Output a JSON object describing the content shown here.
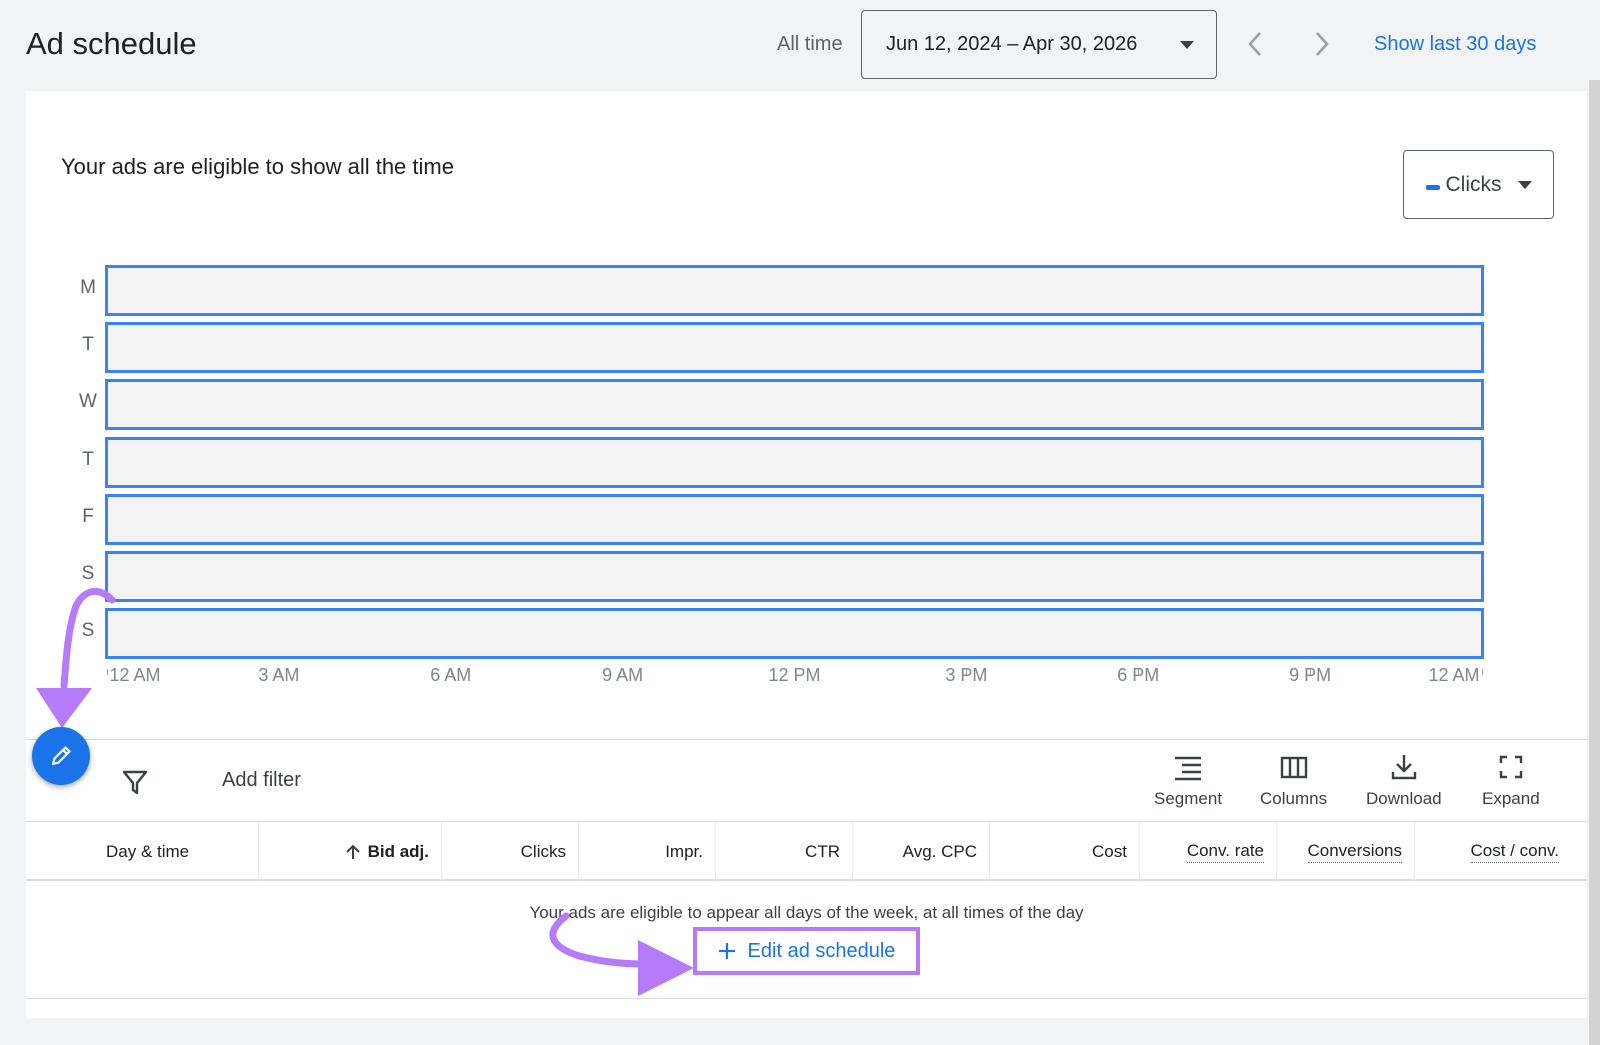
{
  "header": {
    "title": "Ad schedule",
    "range_label": "All time",
    "date_range": "Jun 12, 2024 – Apr 30, 2026",
    "show_last_label": "Show last 30 days"
  },
  "chart": {
    "heading": "Your ads are eligible to show all the time",
    "metric": "Clicks",
    "accent_color": "#1a73e8",
    "bar_border_color": "#3b82f6"
  },
  "chart_data": {
    "type": "heatmap",
    "rows": [
      "M",
      "T",
      "W",
      "T",
      "F",
      "S",
      "S"
    ],
    "x_ticks": [
      "12 AM",
      "3 AM",
      "6 AM",
      "9 AM",
      "12 PM",
      "3 PM",
      "6 PM",
      "9 PM",
      "12 AM"
    ],
    "eligible_all_day": [
      true,
      true,
      true,
      true,
      true,
      true,
      true
    ]
  },
  "toolbar": {
    "add_filter": "Add filter",
    "segment": "Segment",
    "columns": "Columns",
    "download": "Download",
    "expand": "Expand"
  },
  "table": {
    "columns": [
      "Day & time",
      "Bid adj.",
      "Clicks",
      "Impr.",
      "CTR",
      "Avg. CPC",
      "Cost",
      "Conv. rate",
      "Conversions",
      "Cost / conv."
    ],
    "empty_message": "Your ads are eligible to appear all days of the week, at all times of the day",
    "edit_link": "Edit ad schedule"
  },
  "icons": {
    "fab": "pencil-icon",
    "filter": "filter-icon",
    "sort": "arrow-up-icon",
    "add": "plus-icon"
  },
  "annotation_color": "#b57bf8"
}
